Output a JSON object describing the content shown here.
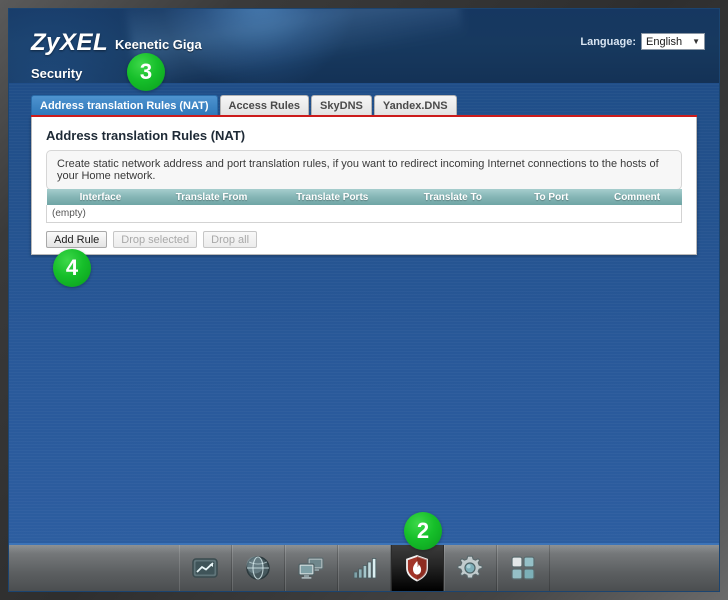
{
  "header": {
    "logo": "ZyXEL",
    "model": "Keenetic Giga",
    "section_title": "Security",
    "language_label": "Language:",
    "language_value": "English",
    "caret": "▼"
  },
  "tabs": [
    {
      "label": "Address translation Rules (NAT)",
      "active": true
    },
    {
      "label": "Access Rules",
      "active": false
    },
    {
      "label": "SkyDNS",
      "active": false
    },
    {
      "label": "Yandex.DNS",
      "active": false
    }
  ],
  "panel": {
    "title": "Address translation Rules (NAT)",
    "description": "Create static network address and port translation rules, if you want to redirect incoming Internet connections to the hosts of your Home network.",
    "table": {
      "columns": [
        "Interface",
        "Translate From",
        "Translate Ports",
        "Translate To",
        "To Port",
        "Comment"
      ],
      "empty_text": "(empty)",
      "rows": []
    },
    "buttons": [
      {
        "label": "Add Rule",
        "enabled": true
      },
      {
        "label": "Drop selected",
        "enabled": false
      },
      {
        "label": "Drop all",
        "enabled": false
      }
    ]
  },
  "badges": [
    {
      "number": "2"
    },
    {
      "number": "3"
    },
    {
      "number": "4"
    }
  ],
  "taskbar": {
    "items": [
      {
        "icon": "monitor-chart-icon",
        "active": false
      },
      {
        "icon": "globe-internet-icon",
        "active": false
      },
      {
        "icon": "home-network-icon",
        "active": false
      },
      {
        "icon": "signal-bars-icon",
        "active": false
      },
      {
        "icon": "shield-firewall-icon",
        "active": true
      },
      {
        "icon": "gear-system-icon",
        "active": false
      },
      {
        "icon": "apps-grid-icon",
        "active": false
      }
    ]
  },
  "colors": {
    "accent_blue": "#2f78ba",
    "tab_underline_red": "#cc1b1b",
    "badge_green": "#16bf2a",
    "table_header_teal": "#86b6b6",
    "header_navy": "#17395f"
  }
}
